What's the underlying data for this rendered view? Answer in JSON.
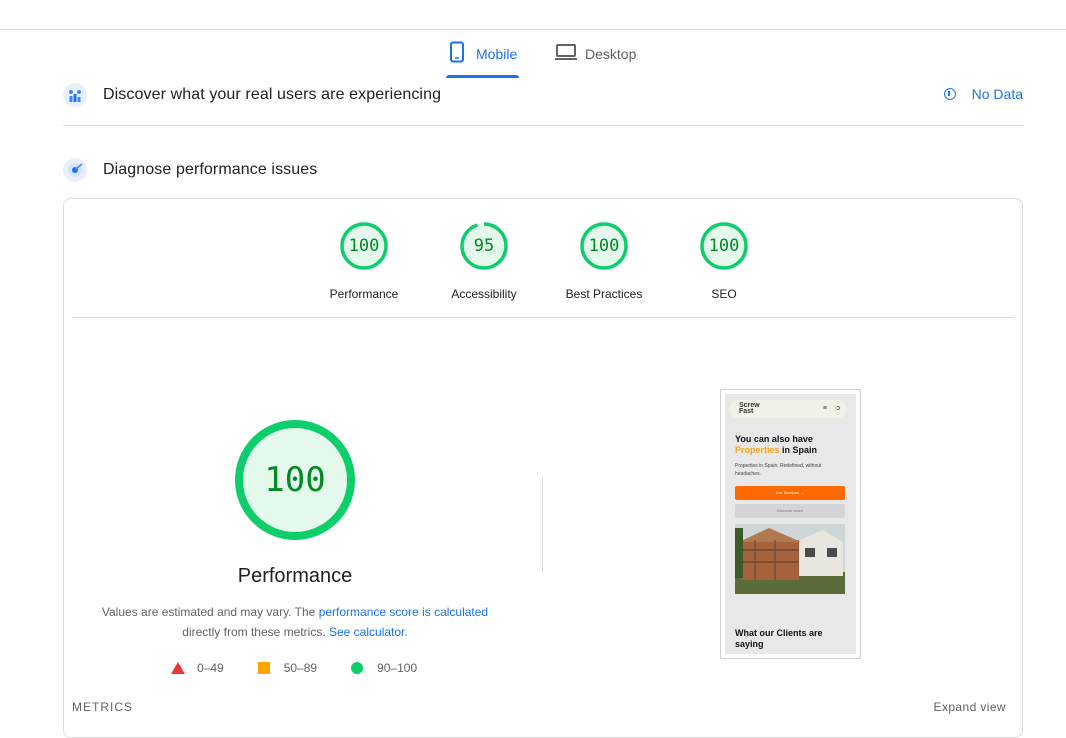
{
  "tabs": [
    {
      "label": "Mobile",
      "icon": "mobile-phone-icon",
      "active": true
    },
    {
      "label": "Desktop",
      "icon": "laptop-icon",
      "active": false
    }
  ],
  "crux": {
    "title": "Discover what your real users are experiencing",
    "status": "No Data",
    "icon": "users-chart-icon"
  },
  "diagnose": {
    "title": "Diagnose performance issues",
    "icon": "lighthouse-icon"
  },
  "categories": [
    {
      "label": "Performance",
      "score": "100",
      "fraction": 1.0
    },
    {
      "label": "Accessibility",
      "score": "95",
      "fraction": 0.95
    },
    {
      "label": "Best Practices",
      "score": "100",
      "fraction": 1.0
    },
    {
      "label": "SEO",
      "score": "100",
      "fraction": 1.0
    }
  ],
  "main": {
    "score": "100",
    "fraction": 1.0,
    "title": "Performance",
    "desc_1": "Values are estimated and may vary. The",
    "link_1": "performance score is calculated",
    "desc_2": "directly from these metrics.",
    "link_2": "See calculator."
  },
  "legend": [
    {
      "range": "0–49",
      "color": "#e53935"
    },
    {
      "range": "50–89",
      "color": "#ffa400"
    },
    {
      "range": "90–100",
      "color": "#0cce6b"
    }
  ],
  "screenshot": {
    "logo_line1": "Screw",
    "logo_line2": "Fast",
    "menu": "≡",
    "more": "ↄ",
    "headline_1": "You can also have",
    "headline_highlight": "Properties",
    "headline_2": "in Spain",
    "subtext": "Properties in Spain. Redefined, without headaches.",
    "primary_btn": "Our Services →",
    "secondary_btn": "Discover more",
    "footer_heading": "What our Clients are saying"
  },
  "metrics": {
    "label": "METRICS",
    "expand": "Expand view"
  },
  "colors": {
    "accent": "#1a73e8",
    "pass": "#0cce6b",
    "pass_text": "#008a25"
  }
}
